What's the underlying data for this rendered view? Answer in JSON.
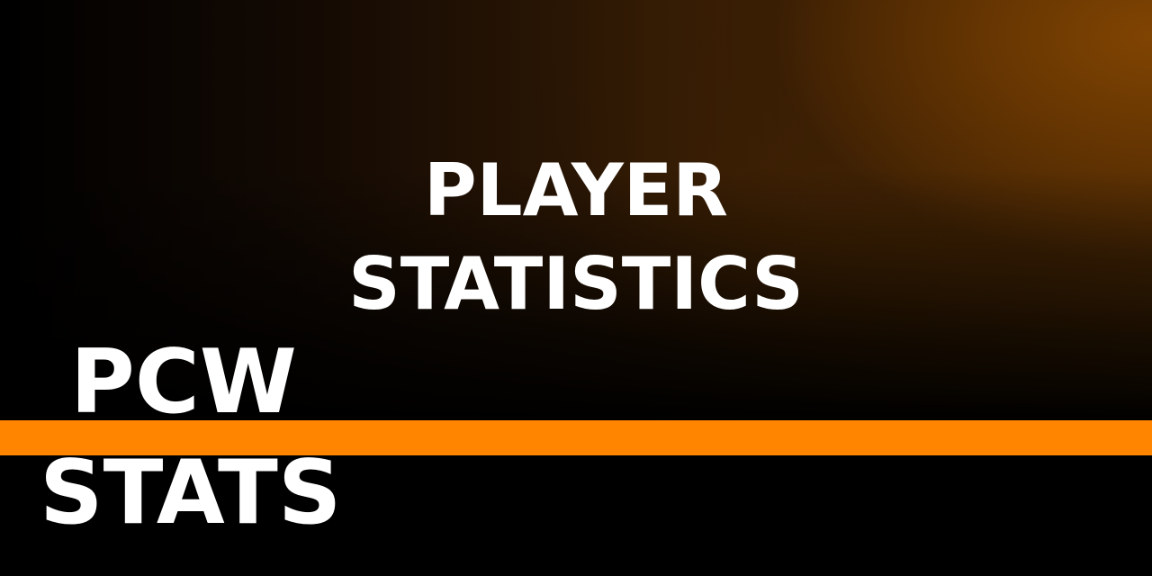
{
  "headline": {
    "line1": "PLAYER",
    "line2": "STATISTICS"
  },
  "logo": {
    "line1": "PCW",
    "line2": "STATS"
  },
  "colors": {
    "accent": "#FF8500",
    "background": "#000000",
    "glow": "#804402",
    "text": "#FFFFFF"
  }
}
